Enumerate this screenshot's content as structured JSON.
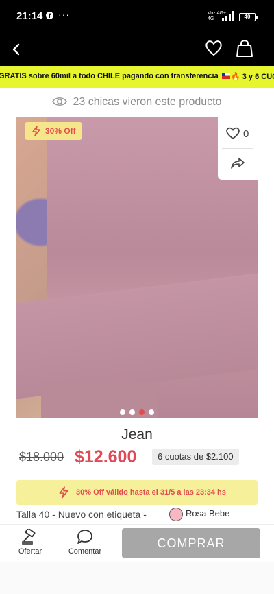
{
  "status_bar": {
    "time": "21:14",
    "facebook_glyph": "f",
    "more": "···",
    "network_line1": "Voz 4G+",
    "network_line2": "4G",
    "battery": "40"
  },
  "top_bar": {
    "back_icon": "chevron-left-icon",
    "favorite_icon": "heart-icon",
    "cart_icon": "shopping-bag-icon"
  },
  "promo": {
    "text": "GRATIS sobre 60mil a todo CHILE pagando con transferencia",
    "text2": "🔥 3 y 6 CUOT",
    "background": "#e6f52d"
  },
  "viewers": {
    "text": "23 chicas vieron este producto"
  },
  "product": {
    "discount_badge": "30% Off",
    "likes": "0",
    "images_count": 4,
    "active_image": 3,
    "title": "Jean",
    "price_old": "$18.000",
    "price_new": "$12.600",
    "installments": "6 cuotas de $2.100",
    "offer_text": "30% Off válido hasta el 31/5 a las 23:34 hs",
    "details": "Talla 40 - Nuevo con etiqueta -",
    "color_name": "Rosa Bebe",
    "color_hex": "#f7b8c3",
    "accent": "#e04a57"
  },
  "bottom_bar": {
    "ofertar": "Ofertar",
    "comentar": "Comentar",
    "comprar": "COMPRAR"
  }
}
